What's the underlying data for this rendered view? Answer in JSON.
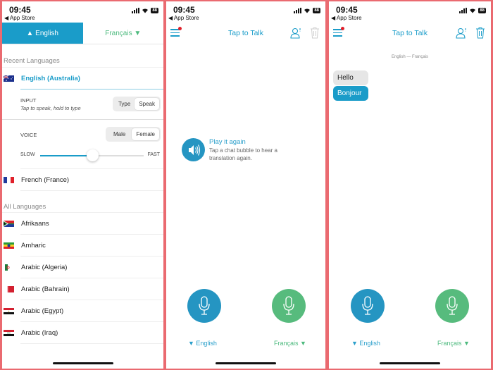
{
  "status_bar": {
    "time": "09:45",
    "back_label": "◀ App Store",
    "battery": "88"
  },
  "panel1": {
    "tabs": [
      {
        "label": "▲ English",
        "active": true
      },
      {
        "label": "Français ▼",
        "active": false
      }
    ],
    "recent_header": "Recent Languages",
    "recent": [
      {
        "label": "English (Australia)",
        "flag": "au-flag-icon",
        "selected": true
      },
      {
        "label": "French (France)",
        "flag": "fr-flag-icon",
        "selected": false
      }
    ],
    "input": {
      "label": "INPUT",
      "hint": "Tap to speak, hold to type",
      "options": [
        "Type",
        "Speak"
      ],
      "selected": "Speak"
    },
    "voice": {
      "label": "VOICE",
      "options": [
        "Male",
        "Female"
      ],
      "selected": "Female"
    },
    "speed": {
      "min_label": "SLOW",
      "max_label": "FAST",
      "value": 0.5
    },
    "all_header": "All Languages",
    "all": [
      {
        "label": "Afrikaans",
        "flag": "za-flag-icon"
      },
      {
        "label": "Amharic",
        "flag": "et-flag-icon"
      },
      {
        "label": "Arabic (Algeria)",
        "flag": "dz-flag-icon"
      },
      {
        "label": "Arabic (Bahrain)",
        "flag": "bh-flag-icon"
      },
      {
        "label": "Arabic (Egypt)",
        "flag": "eg-flag-icon"
      },
      {
        "label": "Arabic (Iraq)",
        "flag": "iq-flag-icon"
      }
    ]
  },
  "panel2": {
    "title": "Tap to Talk",
    "hint_title": "Play it again",
    "hint_body": "Tap a chat bubble to hear a translation again.",
    "left_lang": "▼ English",
    "right_lang": "Français ▼"
  },
  "panel3": {
    "title": "Tap to Talk",
    "conversation_header": "English  —  Français",
    "messages": [
      {
        "text": "Hello",
        "kind": "source"
      },
      {
        "text": "Bonjour",
        "kind": "translation"
      }
    ],
    "left_lang": "▼ English",
    "right_lang": "Français ▼"
  },
  "colors": {
    "accent_blue": "#1a9cc9",
    "accent_green": "#57bb7d",
    "notification_red": "#e0202a",
    "frame": "#ea6a70"
  }
}
